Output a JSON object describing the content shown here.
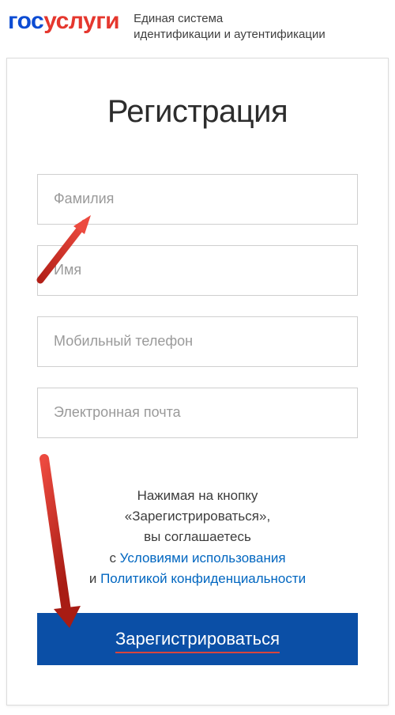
{
  "header": {
    "logo_part1": "гос",
    "logo_part2": "услуги",
    "subtitle_line1": "Единая система",
    "subtitle_line2": "идентификации и аутентификации"
  },
  "page": {
    "title": "Регистрация"
  },
  "form": {
    "surname_placeholder": "Фамилия",
    "name_placeholder": "Имя",
    "phone_placeholder": "Мобильный телефон",
    "email_placeholder": "Электронная почта"
  },
  "agreement": {
    "line1": "Нажимая на кнопку",
    "line2": "«Зарегистрироваться»,",
    "line3": "вы соглашаетесь",
    "line4_prefix": "с ",
    "terms_link": "Условиями использования",
    "line5_prefix": "и ",
    "privacy_link": "Политикой конфиденциальности"
  },
  "button": {
    "register_label": "Зарегистрироваться"
  }
}
